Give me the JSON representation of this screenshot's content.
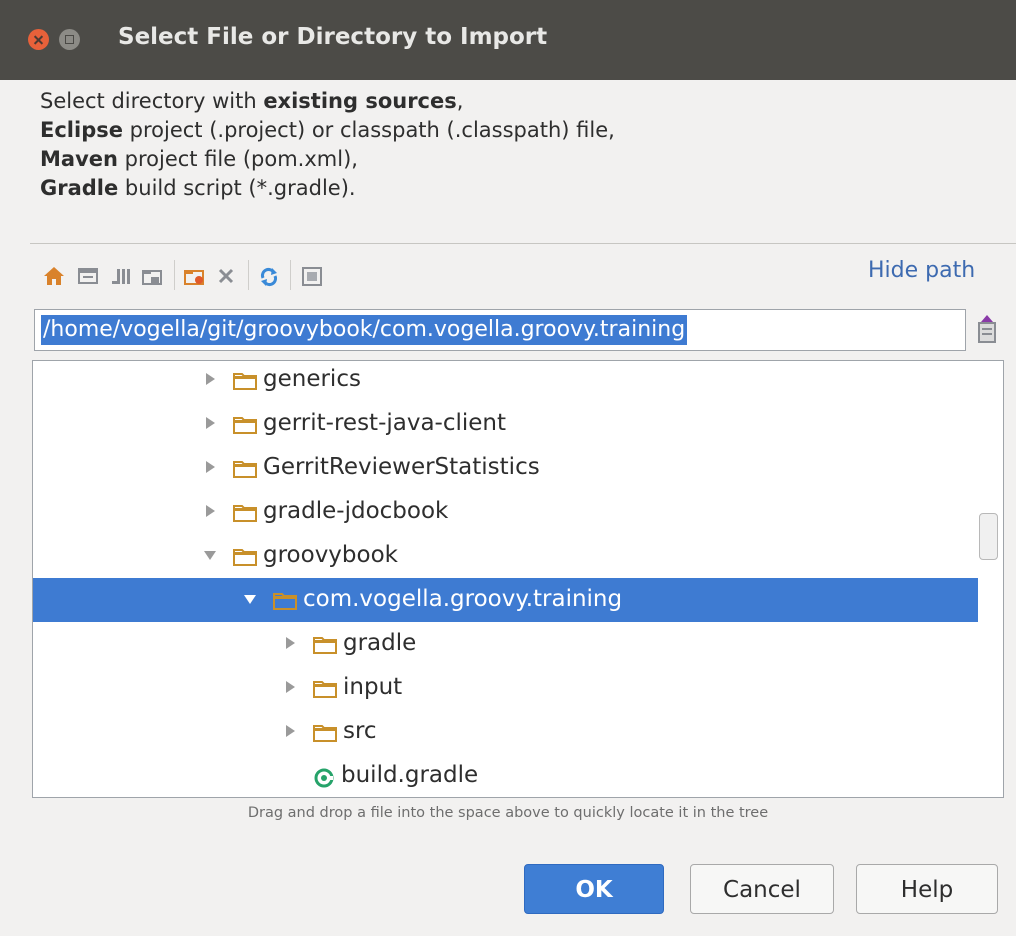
{
  "window": {
    "title": "Select File or Directory to Import"
  },
  "description": {
    "line1_text": "Select directory with ",
    "line1_bold": "existing sources",
    "line1_tail": ",",
    "line2_bold": "Eclipse",
    "line2_text": " project (.project) or classpath (.classpath) file,",
    "line3_bold": "Maven",
    "line3_text": " project file (pom.xml),",
    "line4_bold": "Gradle",
    "line4_text": " build script (*.gradle)."
  },
  "toolbar": {
    "icons": [
      "home-icon",
      "desktop-icon",
      "project-icon",
      "module-icon",
      "new-folder-icon",
      "delete-icon",
      "refresh-icon",
      "show-hidden-icon"
    ],
    "hide_path_label": "Hide path"
  },
  "path": {
    "value": "/home/vogella/git/groovybook/com.vogella.groovy.training"
  },
  "tree": {
    "items": [
      {
        "label": "generics",
        "expanded": false,
        "depth": 1,
        "type": "folder"
      },
      {
        "label": "gerrit-rest-java-client",
        "expanded": false,
        "depth": 1,
        "type": "folder"
      },
      {
        "label": "GerritReviewerStatistics",
        "expanded": false,
        "depth": 1,
        "type": "folder"
      },
      {
        "label": "gradle-jdocbook",
        "expanded": false,
        "depth": 1,
        "type": "folder"
      },
      {
        "label": "groovybook",
        "expanded": true,
        "depth": 1,
        "type": "folder"
      },
      {
        "label": "com.vogella.groovy.training",
        "expanded": true,
        "depth": 2,
        "type": "folder",
        "selected": true
      },
      {
        "label": "gradle",
        "expanded": false,
        "depth": 3,
        "type": "folder"
      },
      {
        "label": "input",
        "expanded": false,
        "depth": 3,
        "type": "folder"
      },
      {
        "label": "src",
        "expanded": false,
        "depth": 3,
        "type": "folder"
      },
      {
        "label": "build.gradle",
        "depth": 3,
        "type": "gradle-file"
      }
    ]
  },
  "hint": "Drag and drop a file into the space above to quickly locate it in the tree",
  "buttons": {
    "ok": "OK",
    "cancel": "Cancel",
    "help": "Help"
  },
  "colors": {
    "titlebar": "#4c4b47",
    "selection": "#3e7bd2",
    "folder": "#c8902a",
    "link": "#3d6ab0"
  }
}
